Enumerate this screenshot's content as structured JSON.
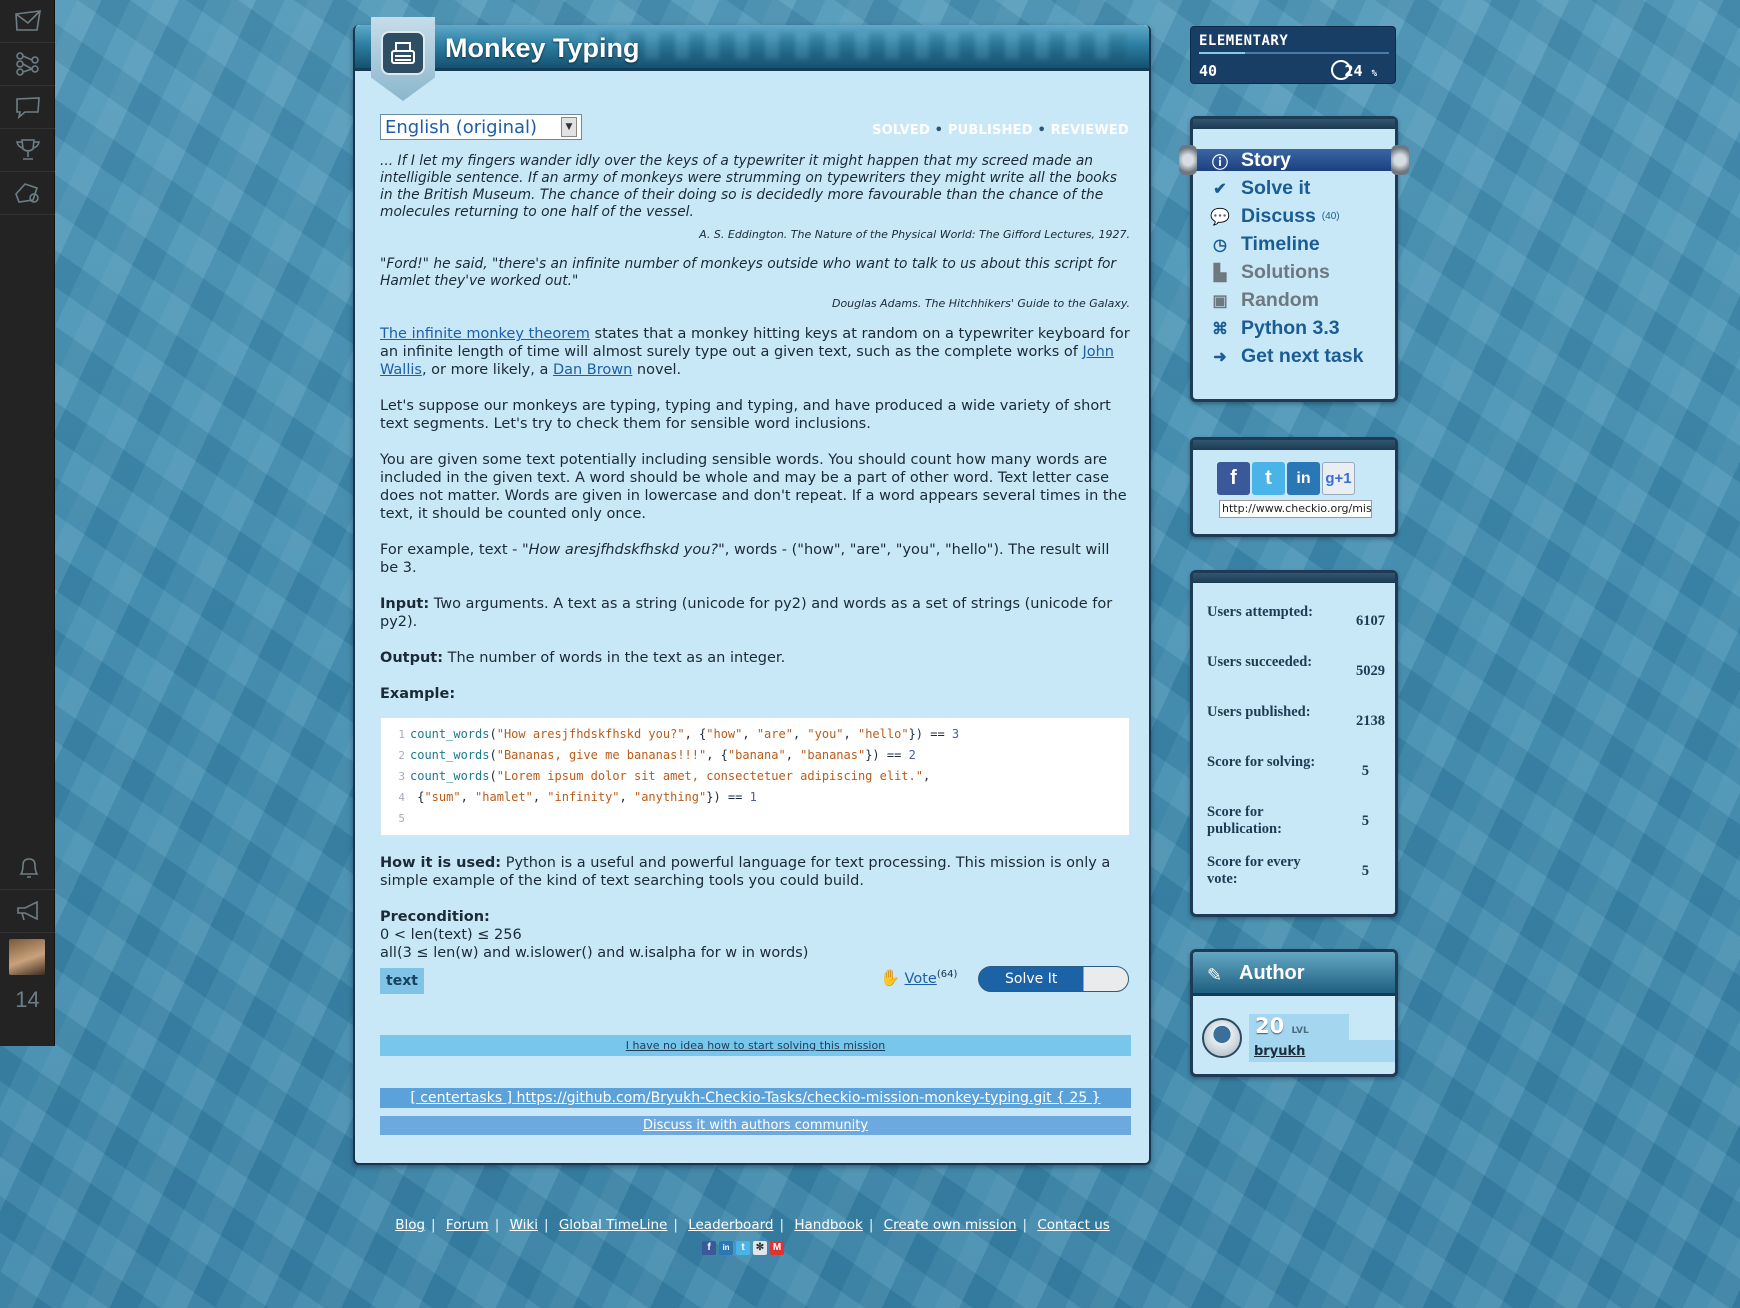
{
  "rail": {
    "top_items": [
      "mail-icon",
      "tree-icon",
      "chat-icon",
      "trophy-icon",
      "settings-map-icon"
    ],
    "bottom_items": [
      "bell-icon",
      "megaphone-icon"
    ],
    "notification_count": "14"
  },
  "mission": {
    "title": "Monkey Typing",
    "language": "English (original)",
    "status": [
      "SOLVED",
      "PUBLISHED",
      "REVIEWED"
    ],
    "quote1": "... If I let my fingers wander idly over the keys of a typewriter it might happen that my screed made an intelligible sentence. If an army of monkeys were strumming on typewriters they might write all the books in the British Museum. The chance of their doing so is decidedly more favourable than the chance of the molecules returning to one half of the vessel.",
    "quote1_source": "A. S. Eddington. The Nature of the Physical World: The Gifford Lectures, 1927.",
    "quote2": "\"Ford!\" he said, \"there's an infinite number of monkeys outside who want to talk to us about this script for Hamlet they've worked out.\"",
    "quote2_source": "Douglas Adams. The Hitchhikers' Guide to the Galaxy.",
    "intro_link": "The infinite monkey theorem",
    "intro_text1": " states that a monkey hitting keys at random on a typewriter keyboard for an infinite length of time will almost surely type out a given text, such as the complete works of ",
    "intro_link2": "John Wallis",
    "intro_text2": ", or more likely, a ",
    "intro_link3": "Dan Brown",
    "intro_text3": " novel.",
    "para1": "Let's suppose our monkeys are typing, typing and typing, and have produced a wide variety of short text segments. Let's try to check them for sensible word inclusions.",
    "para2": "You are given some text potentially including sensible words. You should count how many words are included in the given text. A word should be whole and may be a part of other word. Text letter case does not matter. Words are given in lowercase and don't repeat. If a word appears several times in the text, it should be counted only once.",
    "example_pre": "For example, text - \"",
    "example_italic": "How aresjfhdskfhskd you?",
    "example_post": "\", words - (\"how\", \"are\", \"you\", \"hello\"). The result will be 3.",
    "input_label": "Input:",
    "input_text": " Two arguments. A text as a string (unicode for py2) and words as a set of strings (unicode for py2).",
    "output_label": "Output:",
    "output_text": " The number of words in the text as an integer.",
    "example_label": "Example:",
    "code_lines": [
      {
        "num": "1",
        "fn": "count_words",
        "a": "(",
        "s1": "\"How aresjfhdskfhskd you?\"",
        "b": ", {",
        "w": [
          "\"how\"",
          "\"are\"",
          "\"you\"",
          "\"hello\""
        ],
        "c": "}) == ",
        "r": "3"
      },
      {
        "num": "2",
        "fn": "count_words",
        "a": "(",
        "s1": "\"Bananas, give me bananas!!!\"",
        "b": ", {",
        "w": [
          "\"banana\"",
          "\"bananas\""
        ],
        "c": "}) == ",
        "r": "2"
      },
      {
        "num": "3",
        "fn": "count_words",
        "a": "(",
        "s1": "\"Lorem ipsum dolor sit amet, consectetuer adipiscing elit.\"",
        "b": ",",
        "w": [],
        "c": "",
        "r": ""
      },
      {
        "num": "4",
        "fn": "",
        "a": "            {",
        "s1": "",
        "b": "",
        "w": [
          "\"sum\"",
          "\"hamlet\"",
          "\"infinity\"",
          "\"anything\""
        ],
        "c": "}) == ",
        "r": "1"
      },
      {
        "num": "5",
        "fn": "",
        "a": "",
        "s1": "",
        "b": "",
        "w": [],
        "c": "",
        "r": ""
      }
    ],
    "howused_label": "How it is used:",
    "howused_text": " Python is a useful and powerful language for text processing. This mission is only a simple example of the kind of text searching tools you could build.",
    "precondition_label": "Precondition:",
    "precondition_lines": [
      "0 < len(text) ≤ 256",
      "all(3 ≤ len(w) and w.islower() and w.isalpha for w in words)"
    ],
    "tag": "text",
    "vote_label": "Vote",
    "vote_count": "(64)",
    "solve_label": "Solve It",
    "help_link": "I have no idea how to start solving this mission",
    "repo_link": "[ centertasks ] https://github.com/Bryukh-Checkio-Tasks/checkio-mission-monkey-typing.git { 25 }",
    "discuss_link": "Discuss it with authors community"
  },
  "level": {
    "title": "ELEMENTARY",
    "score": "40",
    "percent": "24",
    "percent_unit": "%",
    "progress": 0.24
  },
  "nav": {
    "items": [
      {
        "label": "Story",
        "icon": "info-icon",
        "active": true
      },
      {
        "label": "Solve it",
        "icon": "check-icon"
      },
      {
        "label": "Discuss",
        "icon": "discuss-icon",
        "count": "(40)"
      },
      {
        "label": "Timeline",
        "icon": "clock-icon"
      },
      {
        "label": "Solutions",
        "icon": "solutions-icon",
        "muted": true
      },
      {
        "label": "Random",
        "icon": "random-icon",
        "muted": true
      },
      {
        "label": "Python 3.3",
        "icon": "python-icon"
      },
      {
        "label": "Get next task",
        "icon": "next-icon"
      }
    ]
  },
  "share": {
    "url": "http://www.checkio.org/mission/monkey-typing/"
  },
  "stats": [
    {
      "label": "Users attempted:",
      "value": "6107"
    },
    {
      "label": "Users succeeded:",
      "value": "5029"
    },
    {
      "label": "Users published:",
      "value": "2138"
    },
    {
      "label": "Score for solving:",
      "value": "5"
    },
    {
      "label": "Score for publication:",
      "value": "5"
    },
    {
      "label": "Score for every vote:",
      "value": "5"
    }
  ],
  "author": {
    "title": "Author",
    "level": "20",
    "level_unit": "LVL",
    "name": "bryukh"
  },
  "footer": {
    "links": [
      "Blog",
      "Forum",
      "Wiki",
      "Global TimeLine",
      "Leaderboard",
      "Handbook",
      "Create own mission",
      "Contact us"
    ]
  },
  "colors": {
    "accent": "#1e5ea8",
    "panel": "#c9e8f7",
    "dark": "#19344d"
  }
}
